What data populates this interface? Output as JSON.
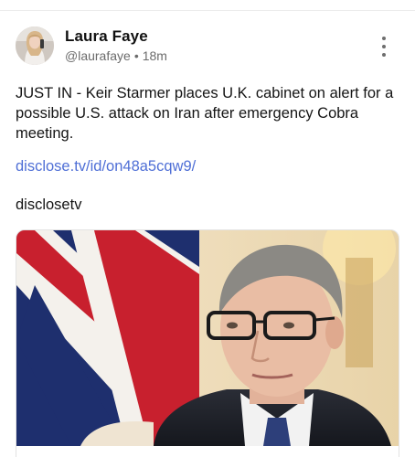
{
  "post": {
    "author": {
      "display_name": "Laura Faye",
      "handle": "@laurafaye",
      "separator": "•",
      "time_ago": "18m"
    },
    "body_text": "JUST IN - Keir Starmer places U.K. cabinet on alert for a possible U.S. attack on Iran after emergency Cobra meeting.",
    "link_text": "disclose.tv/id/on48a5cqw9/",
    "source_text": "disclosetv"
  },
  "icons": {
    "more": "more-vertical-icon"
  },
  "colors": {
    "link": "#4f6fd6",
    "meta_text": "#6b6b6b",
    "flag_red": "#c8202e",
    "flag_blue": "#1e2f6e"
  }
}
